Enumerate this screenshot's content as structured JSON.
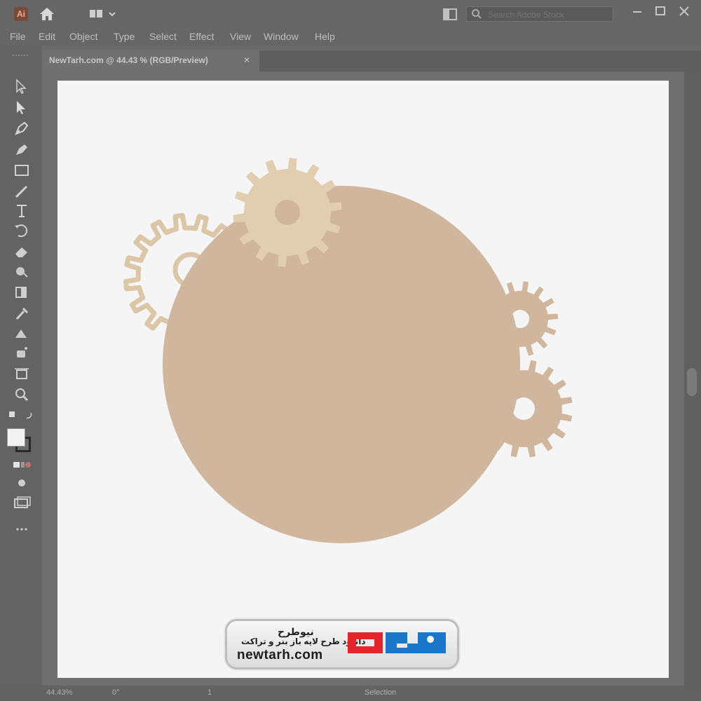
{
  "app": {
    "logo_text": "Ai",
    "workspace_icon": "grid-icon",
    "search_placeholder": "Search Adobe Stock"
  },
  "menu": {
    "items": [
      {
        "label": "File"
      },
      {
        "label": "Edit"
      },
      {
        "label": "Object"
      },
      {
        "label": "Type"
      },
      {
        "label": "Select"
      },
      {
        "label": "Effect"
      },
      {
        "label": "View"
      },
      {
        "label": "Window"
      },
      {
        "label": "Help"
      }
    ]
  },
  "document": {
    "tab_title": "NewTarh.com @ 44.43 % (RGB/Preview)",
    "close_glyph": "×"
  },
  "statusbar": {
    "zoom": "44.43%",
    "rotation": "0°",
    "artboard": "1",
    "tool": "Selection"
  },
  "colors": {
    "circle": "#cfb69c",
    "gear_light": "#e1cdb0",
    "gear_outline": "#dcc6a8",
    "artboard": "#f5f5f5"
  },
  "watermark": {
    "brand": "نیوطرح",
    "tagline": "دانلود طرح لایه باز بنر و تراکت",
    "url": "newtarh.com",
    "logo_color": "#1976c9",
    "logo_accent": "#e3262b"
  }
}
